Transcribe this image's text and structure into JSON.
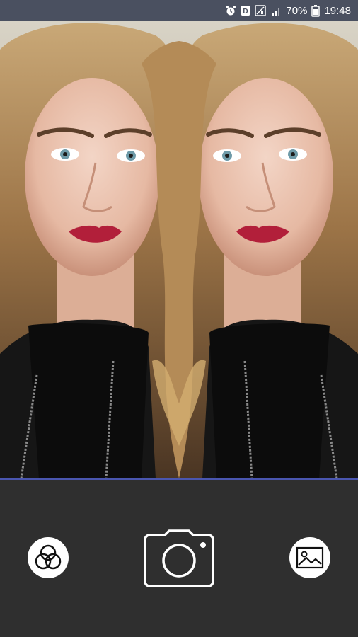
{
  "status_bar": {
    "battery": "70%",
    "time": "19:48",
    "icons": [
      "alarm-icon",
      "notification-icon",
      "no-sim-icon",
      "signal-icon",
      "battery-icon"
    ]
  },
  "preview": {
    "description_icon": "mirror-camera-preview"
  },
  "controls": {
    "effects_icon": "effects-circles-icon",
    "capture_icon": "camera-icon",
    "gallery_icon": "gallery-image-icon"
  },
  "colors": {
    "status_bar_bg": "#4a5060",
    "control_bar_bg": "#2f2f2f",
    "divider": "#4a56b0",
    "icon_white": "#ffffff"
  }
}
